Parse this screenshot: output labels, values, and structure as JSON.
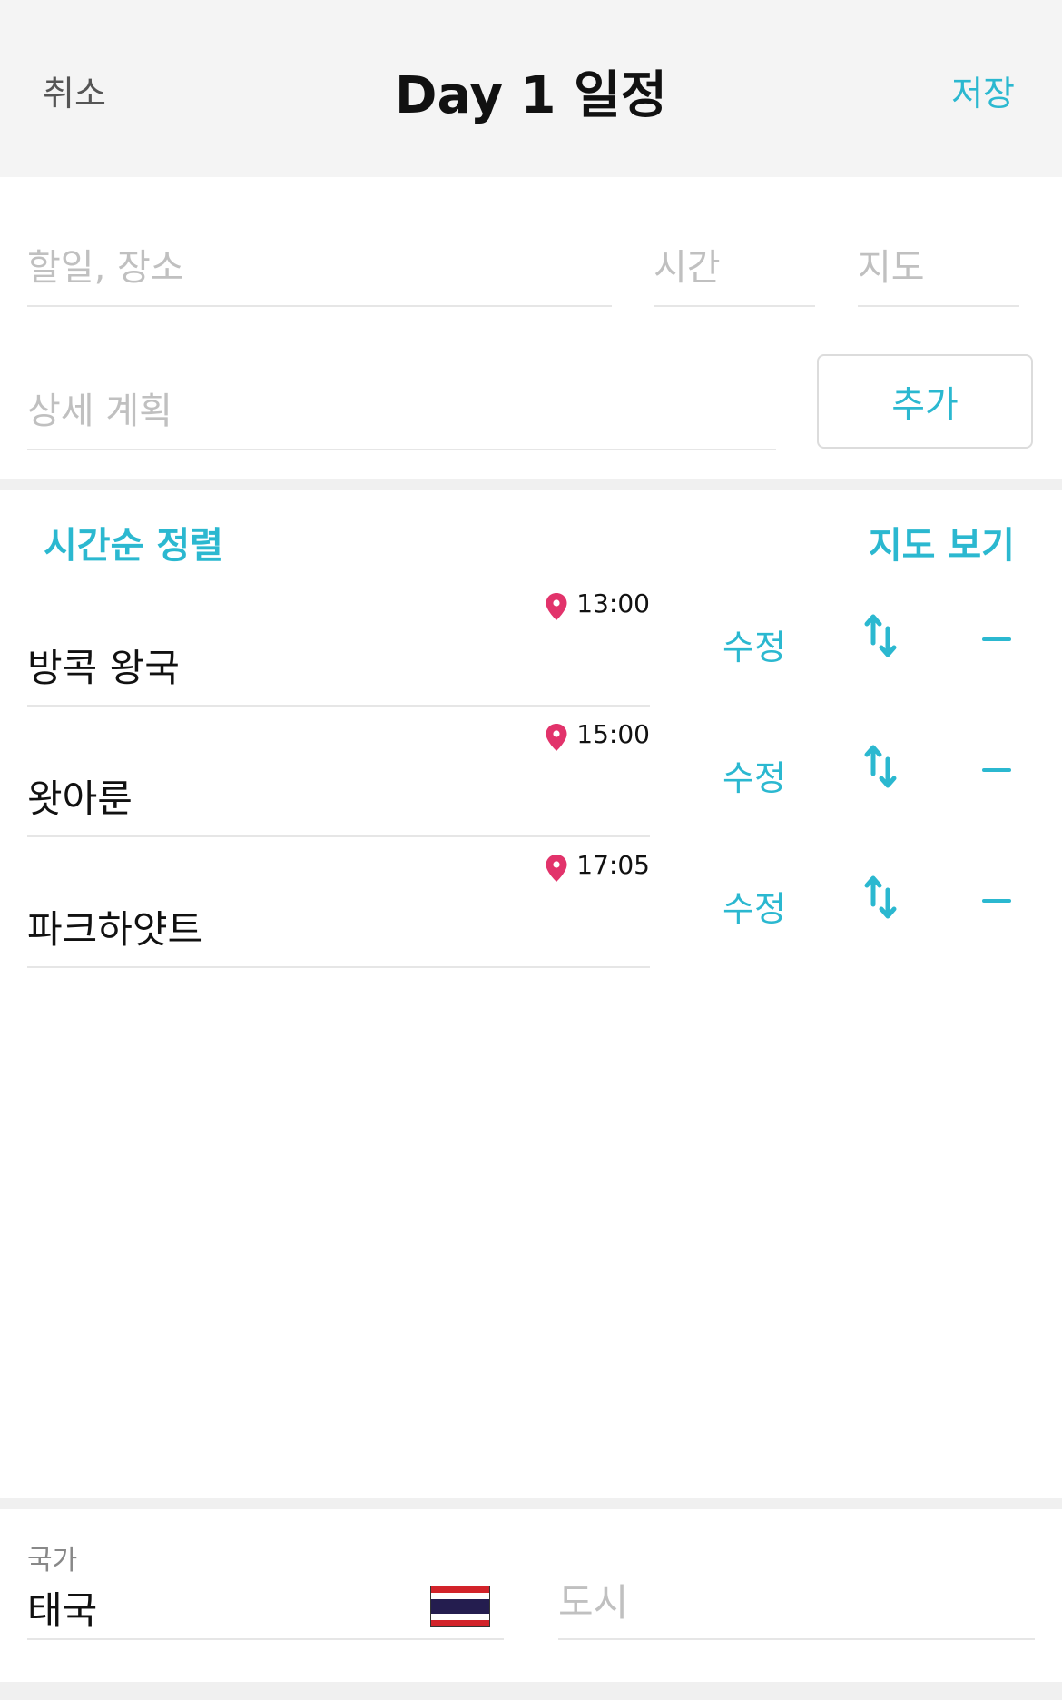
{
  "header": {
    "cancel_label": "취소",
    "title": "Day 1 일정",
    "save_label": "저장"
  },
  "form": {
    "todo_placeholder": "할일, 장소",
    "time_placeholder": "시간",
    "map_placeholder": "지도",
    "detail_placeholder": "상세 계획",
    "add_label": "추가"
  },
  "toolbar": {
    "sort_label": "시간순 정렬",
    "map_view_label": "지도 보기"
  },
  "schedule": [
    {
      "name": "방콕 왕국",
      "time": "13:00",
      "edit_label": "수정"
    },
    {
      "name": "왓아룬",
      "time": "15:00",
      "edit_label": "수정"
    },
    {
      "name": "파크하얏트",
      "time": "17:05",
      "edit_label": "수정"
    }
  ],
  "location": {
    "country_label": "국가",
    "country_value": "태국",
    "city_placeholder": "도시"
  },
  "colors": {
    "accent": "#2bb8d0",
    "pin": "#e2336b"
  },
  "icons": {
    "pin": "location-pin-icon",
    "reorder": "reorder-arrows-icon",
    "remove": "minus-icon",
    "flag": "thailand-flag-icon"
  }
}
